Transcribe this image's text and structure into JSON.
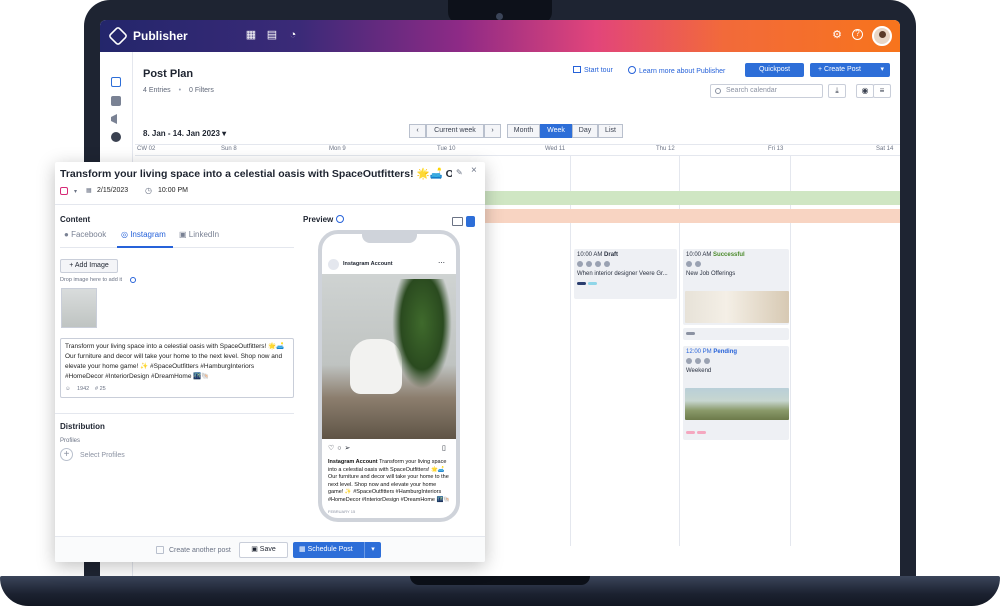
{
  "app": {
    "name": "Publisher"
  },
  "topbar": {
    "icons": [
      "grid-icon",
      "calendar-icon",
      "dashboard-icon",
      "gear-icon",
      "help-icon",
      "avatar"
    ]
  },
  "page": {
    "title": "Post Plan",
    "entries": "4 Entries",
    "filters": "0 Filters",
    "start_tour": "Start tour",
    "learn_more": "Learn more about Publisher",
    "quickpost": "Quickpost",
    "create_post": "+ Create Post",
    "search_placeholder": "Search calendar"
  },
  "calendar": {
    "date_range": "8. Jan - 14. Jan 2023",
    "nav": {
      "current_week": "Current week"
    },
    "views": [
      "Month",
      "Week",
      "Day",
      "List"
    ],
    "active_view": "Week",
    "week_label": "CW 02",
    "days": [
      "Sun 8",
      "Mon 9",
      "Tue 10",
      "Wed 11",
      "Thu 12",
      "Fri 13",
      "Sat 14"
    ],
    "band_colors": [
      "#cfe6c3",
      "#f8d4c2"
    ],
    "cards": [
      {
        "time": "10:00 AM",
        "status": "Draft",
        "status_color": "#1e2430",
        "text": "When interior designer Veere Gr..."
      },
      {
        "time": "10:00 AM",
        "status": "Successful",
        "status_color": "#4a8a2a",
        "text": "New Job Offerings"
      },
      {
        "time": "12:00 PM",
        "status": "Pending",
        "status_color": "#2662d9",
        "text": "Weekend"
      }
    ]
  },
  "editor": {
    "title": "Transform your living space into a celestial oasis with SpaceOutfitters! 🌟🛋️ Our ...",
    "date": "2/15/2023",
    "time": "10:00 PM",
    "content_label": "Content",
    "preview_label": "Preview",
    "tabs": [
      "Facebook",
      "Instagram",
      "LinkedIn"
    ],
    "active_tab": "Instagram",
    "add_image": "+ Add Image",
    "drop_hint": "Drop image here to add it",
    "post_text": "Transform your living space into a celestial oasis with SpaceOutfitters! 🌟🛋️ Our furniture and decor will take your home to the next level. Shop now and elevate your home game! ✨ #SpaceOutfitters #HamburgInteriors #HomeDecor #InteriorDesign #DreamHome 🌃🐚",
    "char_count": "1942",
    "hashtag_count": "# 25",
    "distribution_label": "Distribution",
    "profiles_label": "Profiles",
    "select_profiles": "Select Profiles",
    "create_another": "Create another post",
    "save": "Save",
    "schedule": "Schedule Post",
    "ig": {
      "account": "Instagram Account",
      "caption_account": "Instagram Account",
      "caption": "Transform your living space into a celestial oasis with SpaceOutfitters! 🌟🛋️ Our furniture and decor will take your home to the next level. Shop now and elevate your home game! ✨ #SpaceOutfitters #HamburgInteriors #HomeDecor #InteriorDesign #DreamHome 🌃🐚",
      "date": "FEBRUARY 15"
    }
  },
  "colors": {
    "accent": "#2d6ed8",
    "instagram": "#d62976"
  }
}
